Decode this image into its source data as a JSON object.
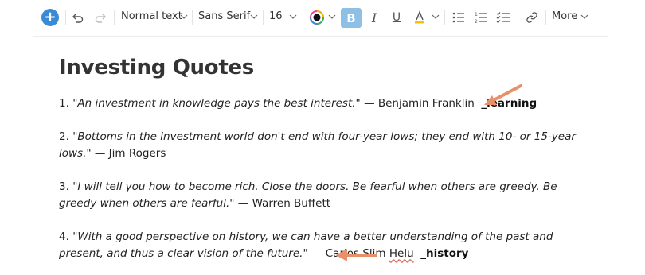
{
  "toolbar": {
    "add": "+",
    "text_style": "Normal text",
    "font_family": "Sans Serif",
    "font_size": "16",
    "bold": "B",
    "italic": "I",
    "underline": "U",
    "more": "More",
    "accent_color": "#3a8bd6",
    "bold_active_color": "#8ec0e6"
  },
  "document": {
    "title": "Investing Quotes",
    "quotes": [
      {
        "number": "1.",
        "text": "\"An investment in knowledge pays the best interest.\"",
        "author": "— Benjamin Franklin",
        "tag": "_learning"
      },
      {
        "number": "2.",
        "text": "\"Bottoms in the investment world don't end with four-year lows; they end with 10- or 15-year lows.\"",
        "author": "— Jim Rogers",
        "tag": ""
      },
      {
        "number": "3.",
        "text": "\"I will tell you how to become rich. Close the doors. Be fearful when others are greedy. Be greedy when others are fearful.\"",
        "author": "— Warren Buffett",
        "tag": ""
      },
      {
        "number": "4.",
        "text": "\"With a good perspective on history, we can have a better understanding of the past and present, and thus a clear vision of the future.\"",
        "author_prefix": "— Carlos Slim ",
        "author_misspelled": "Helu",
        "tag": "_history"
      }
    ]
  },
  "annotation_color": "#e8906a"
}
